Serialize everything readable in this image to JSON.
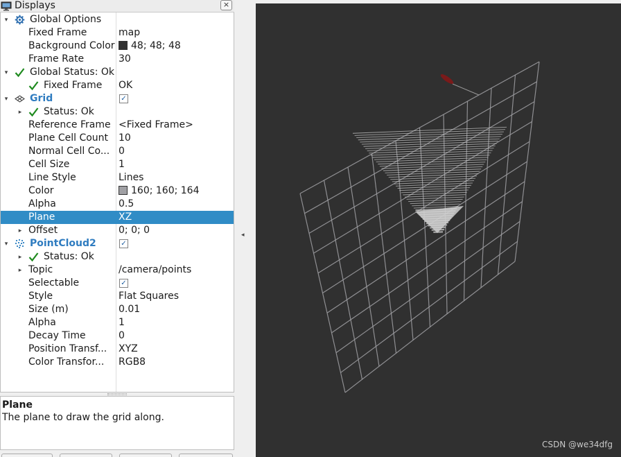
{
  "panel": {
    "title": "Displays",
    "close_icon": "×"
  },
  "tree": [
    {
      "name": "Global Options",
      "value": "",
      "indent": 0,
      "expander": "▾",
      "icon": "gear-icon",
      "style": "normal"
    },
    {
      "name": "Fixed Frame",
      "value": "map",
      "indent": 1
    },
    {
      "name": "Background Color",
      "value": "48; 48; 48",
      "indent": 1,
      "swatch": "#303030"
    },
    {
      "name": "Frame Rate",
      "value": "30",
      "indent": 1
    },
    {
      "name": "Global Status: Ok",
      "value": "",
      "indent": 0,
      "expander": "▾",
      "icon": "check-icon"
    },
    {
      "name": "Fixed Frame",
      "value": "OK",
      "indent": 1,
      "icon": "check-icon"
    },
    {
      "name": "Grid",
      "value": "",
      "indent": 0,
      "expander": "▾",
      "icon": "grid-icon",
      "style": "blue",
      "checkbox": true
    },
    {
      "name": "Status: Ok",
      "value": "",
      "indent": 1,
      "expander": "▸",
      "icon": "check-icon"
    },
    {
      "name": "Reference Frame",
      "value": "<Fixed Frame>",
      "indent": 1
    },
    {
      "name": "Plane Cell Count",
      "value": "10",
      "indent": 1
    },
    {
      "name": "Normal Cell Co...",
      "value": "0",
      "indent": 1
    },
    {
      "name": "Cell Size",
      "value": "1",
      "indent": 1
    },
    {
      "name": "Line Style",
      "value": "Lines",
      "indent": 1
    },
    {
      "name": "Color",
      "value": "160; 160; 164",
      "indent": 1,
      "swatch": "#a0a0a4"
    },
    {
      "name": "Alpha",
      "value": "0.5",
      "indent": 1
    },
    {
      "name": "Plane",
      "value": "XZ",
      "indent": 1,
      "selected": true
    },
    {
      "name": "Offset",
      "value": "0; 0; 0",
      "indent": 1,
      "expander": "▸"
    },
    {
      "name": "PointCloud2",
      "value": "",
      "indent": 0,
      "expander": "▾",
      "icon": "pointcloud-icon",
      "style": "blue",
      "checkbox": true
    },
    {
      "name": "Status: Ok",
      "value": "",
      "indent": 1,
      "expander": "▸",
      "icon": "check-icon"
    },
    {
      "name": "Topic",
      "value": "/camera/points",
      "indent": 1,
      "expander": "▸"
    },
    {
      "name": "Selectable",
      "value": "",
      "indent": 1,
      "checkbox": true
    },
    {
      "name": "Style",
      "value": "Flat Squares",
      "indent": 1
    },
    {
      "name": "Size (m)",
      "value": "0.01",
      "indent": 1
    },
    {
      "name": "Alpha",
      "value": "1",
      "indent": 1
    },
    {
      "name": "Decay Time",
      "value": "0",
      "indent": 1
    },
    {
      "name": "Position Transf...",
      "value": "XYZ",
      "indent": 1
    },
    {
      "name": "Color Transfor...",
      "value": "RGB8",
      "indent": 1
    }
  ],
  "description": {
    "title": "Plane",
    "text": "The plane to draw the grid along."
  },
  "viewport": {
    "background": "#303030",
    "grid_color": "#a0a0a4",
    "watermark": "CSDN @we34dfg"
  },
  "colors": {
    "selection": "#308cc6",
    "blue_label": "#2f7cc0",
    "check": "#1e8a1e"
  }
}
